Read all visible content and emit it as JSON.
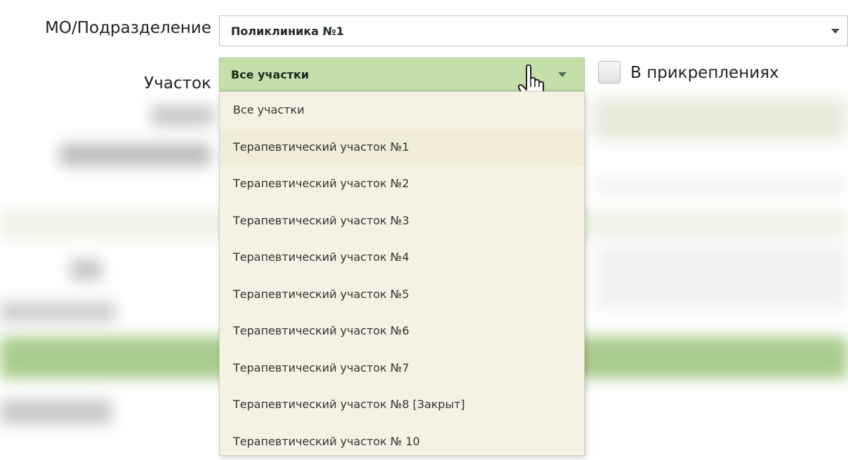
{
  "form": {
    "mo_label": "МО/Подразделение",
    "mo_value": "Поликлиника №1",
    "uchastok_label": "Участок",
    "uchastok_value": "Все участки",
    "attachments_label": "В прикреплениях",
    "attachments_checked": false
  },
  "dropdown": {
    "options": [
      "Все участки",
      "Терапевтический участок №1",
      "Терапевтический участок №2",
      "Терапевтический участок №3",
      "Терапевтический участок №4",
      "Терапевтический участок №5",
      "Терапевтический участок №6",
      "Терапевтический участок №7",
      "Терапевтический участок №8 [Закрыт]",
      "Терапевтический участок № 10"
    ]
  },
  "colors": {
    "selected_field_bg": "#c5dfaa",
    "dropdown_bg": "#f6f2e3",
    "highlight_row": "#a9cc8c"
  },
  "icons": {
    "cursor": "hand-pointer-icon",
    "arrow": "chevron-down-icon"
  }
}
